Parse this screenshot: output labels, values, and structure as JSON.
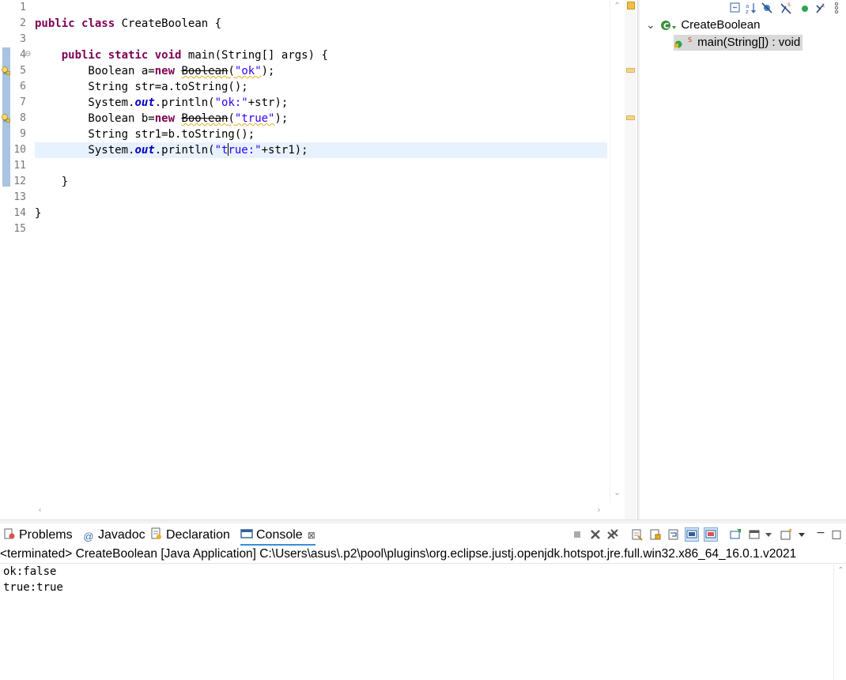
{
  "editor": {
    "line_numbers": [
      "1",
      "2",
      "3",
      "4",
      "5",
      "6",
      "7",
      "8",
      "9",
      "10",
      "11",
      "12",
      "13",
      "14",
      "15"
    ],
    "fold_marker": "⊖",
    "lines": {
      "l2": {
        "kw1": "public",
        "kw2": "class",
        "rest": " CreateBoolean {"
      },
      "l4": {
        "indent": "    ",
        "kw1": "public",
        "kw2": "static",
        "kw3": "void",
        "rest": " main(String[] args) {"
      },
      "l5": {
        "pre": "        Boolean a=",
        "kw": "new",
        "sp": " ",
        "depr": "Boolean",
        "open": "(",
        "str": "\"ok\"",
        "close": ");"
      },
      "l6": {
        "text": "        String str=a.toString();"
      },
      "l7": {
        "pre": "        System.",
        "fld": "out",
        "mid": ".println(",
        "str": "\"ok:\"",
        "post": "+str);"
      },
      "l8": {
        "pre": "        Boolean b=",
        "kw": "new",
        "sp": " ",
        "depr": "Boolean",
        "open": "(",
        "str": "\"true\"",
        "close": ");"
      },
      "l9": {
        "text": "        String str1=b.toString();"
      },
      "l10": {
        "pre": "        System.",
        "fld": "out",
        "mid": ".println(",
        "str_a": "\"t",
        "str_b": "rue:\"",
        "post": "+str1);"
      },
      "l12": {
        "text": "    }"
      },
      "l14": {
        "text": "}"
      }
    },
    "scroll_up": "⌃",
    "scroll_down": "⌄",
    "scroll_left": "‹",
    "scroll_right": "›"
  },
  "outline": {
    "expand_arrow": "⌄",
    "class_name": "CreateBoolean",
    "method_sig": "main(String[]) : void",
    "toolbar_icons": [
      "collapse-all-icon",
      "sort-icon",
      "hide-fields-icon",
      "hide-static-icon",
      "hide-nonpublic-icon",
      "hide-local-types-icon",
      "view-menu-icon"
    ]
  },
  "console": {
    "tabs": [
      {
        "label": "Problems",
        "icon": "problems-icon"
      },
      {
        "label": "Javadoc",
        "icon": "javadoc-icon"
      },
      {
        "label": "Declaration",
        "icon": "declaration-icon"
      },
      {
        "label": "Console",
        "icon": "console-icon",
        "close": "⊠"
      }
    ],
    "terminated_line": "<terminated> CreateBoolean [Java Application] C:\\Users\\asus\\.p2\\pool\\plugins\\org.eclipse.justj.openjdk.hotspot.jre.full.win32.x86_64_16.0.1.v2021",
    "output": [
      "ok:false",
      "true:true"
    ],
    "minimize": "−",
    "maximize": "□"
  },
  "colors": {
    "keyword": "#7f0055",
    "string": "#2a00ff",
    "field": "#0000c0",
    "current_line": "#e8f2fe",
    "selection_tab": "#3b8fd8"
  }
}
